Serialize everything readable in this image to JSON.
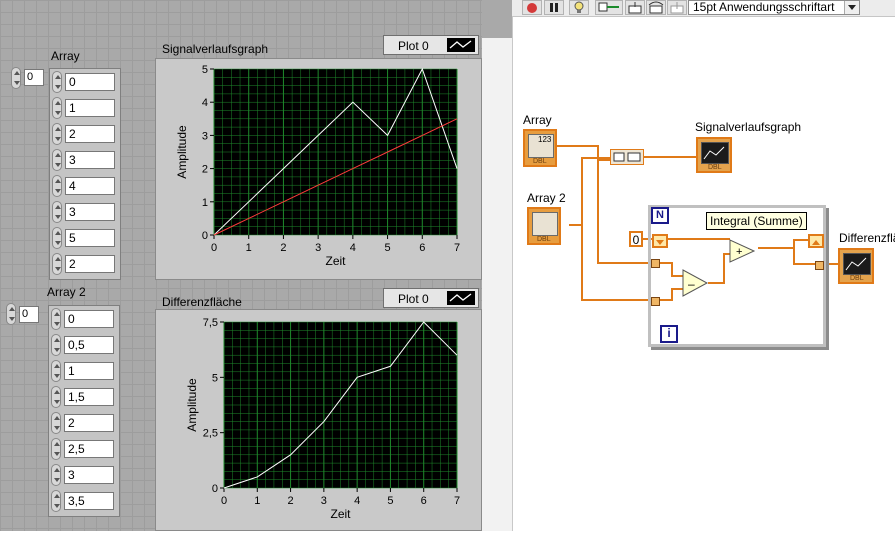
{
  "front_panel": {
    "array1": {
      "label": "Array",
      "index": "0",
      "values": [
        "0",
        "1",
        "2",
        "3",
        "4",
        "3",
        "5",
        "2"
      ]
    },
    "array2": {
      "label": "Array 2",
      "index": "0",
      "values": [
        "0",
        "0,5",
        "1",
        "1,5",
        "2",
        "2,5",
        "3",
        "3,5"
      ]
    },
    "graph1": {
      "title": "Signalverlaufsgraph",
      "legend": "Plot 0",
      "chart_data": {
        "type": "line",
        "x": [
          0,
          1,
          2,
          3,
          4,
          5,
          6,
          7
        ],
        "series": [
          {
            "name": "Plot 0",
            "values": [
              0,
              1,
              2,
              3,
              4,
              3,
              5,
              2
            ],
            "color": "#ffffff"
          },
          {
            "values": [
              0,
              0.5,
              1,
              1.5,
              2,
              2.5,
              3,
              3.5
            ],
            "color": "#ff3b3b"
          }
        ],
        "xlabel": "Zeit",
        "ylabel": "Amplitude",
        "xlim": [
          0,
          7
        ],
        "ylim": [
          0,
          5
        ],
        "yticks": [
          "0",
          "1",
          "2",
          "3",
          "4",
          "5"
        ],
        "xticks": [
          "0",
          "1",
          "2",
          "3",
          "4",
          "5",
          "6",
          "7"
        ],
        "grid": true,
        "plot_bg": "#000000",
        "grid_color": "#1f8a2c"
      }
    },
    "graph2": {
      "title": "Differenzfläche",
      "legend": "Plot 0",
      "chart_data": {
        "type": "line",
        "x": [
          0,
          1,
          2,
          3,
          4,
          5,
          6,
          7
        ],
        "series": [
          {
            "name": "Plot 0",
            "values": [
              0,
              0.5,
              1.5,
              3,
              5,
              5.5,
              7.5,
              6
            ],
            "color": "#ffffff"
          }
        ],
        "xlabel": "Zeit",
        "ylabel": "Amplitude",
        "xlim": [
          0,
          7
        ],
        "ylim": [
          0,
          7.5
        ],
        "yticks": [
          "0",
          "2,5",
          "5",
          "7,5"
        ],
        "xticks": [
          "0",
          "1",
          "2",
          "3",
          "4",
          "5",
          "6",
          "7"
        ],
        "grid": true,
        "plot_bg": "#000000",
        "grid_color": "#1f8a2c"
      }
    }
  },
  "toolbar": {
    "font_select": "15pt Anwendungsschriftart",
    "icons": [
      "stop-icon",
      "pause-icon",
      "highlight-icon",
      "retain-wire-icon",
      "step-into-icon",
      "step-over-icon",
      "step-out-icon"
    ]
  },
  "block_diagram": {
    "array_label": "Array",
    "array2_label": "Array 2",
    "graph1_label": "Signalverlaufsgraph",
    "graph2_label": "Differenzfläche",
    "terminal_type": "DBL",
    "terminal_num": "123",
    "loop_n": "N",
    "loop_i": "i",
    "constant": "0",
    "tooltip": "Integral (Summe)",
    "wire_color": "#e07a18"
  }
}
